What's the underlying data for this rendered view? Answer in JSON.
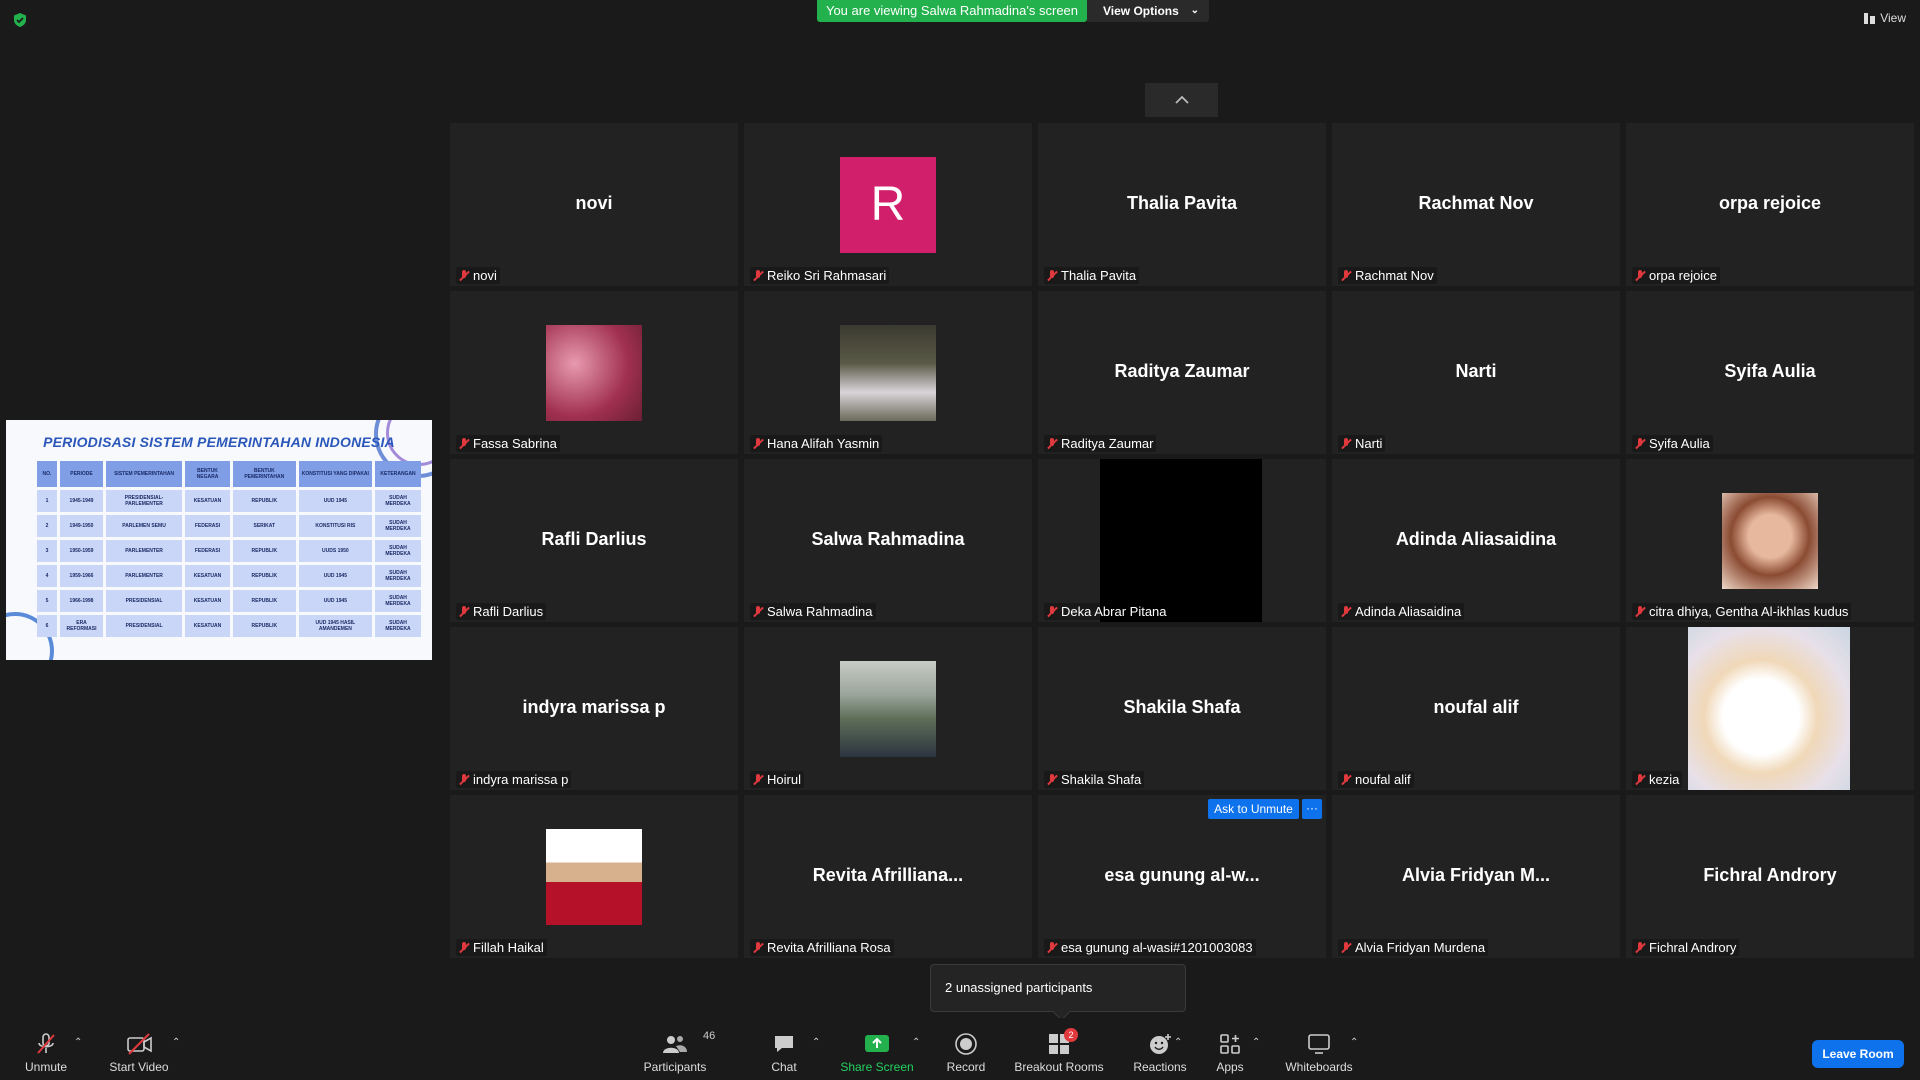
{
  "top": {
    "banner": "You are viewing Salwa Rahmadina's screen",
    "view_options": "View Options",
    "view": "View"
  },
  "slide": {
    "title": "PERIODISASI SISTEM PEMERINTAHAN INDONESIA",
    "headers": [
      "NO.",
      "PERIODE",
      "SISTEM PEMERINTAHAN",
      "BENTUK NEGARA",
      "BENTUK PEMERINTAHAN",
      "KONSTITUSI YANG DIPAKAI",
      "KETERANGAN"
    ],
    "rows": [
      [
        "1",
        "1945-1949",
        "PRESIDENSIAL-PARLEMENTER",
        "KESATUAN",
        "REPUBLIK",
        "UUD 1945",
        "SUDAH MERDEKA"
      ],
      [
        "2",
        "1949-1950",
        "PARLEMEN SEMU",
        "FEDERASI",
        "SERIKAT",
        "KONSTITUSI RIS",
        "SUDAH MERDEKA"
      ],
      [
        "3",
        "1950-1959",
        "PARLEMENTER",
        "FEDERASI",
        "REPUBLIK",
        "UUDS 1950",
        "SUDAH MERDEKA"
      ],
      [
        "4",
        "1959-1966",
        "PARLEMENTER",
        "KESATUAN",
        "REPUBLIK",
        "UUD 1945",
        "SUDAH MERDEKA"
      ],
      [
        "5",
        "1966-1998",
        "PRESIDENSIAL",
        "KESATUAN",
        "REPUBLIK",
        "UUD 1945",
        "SUDAH MERDEKA"
      ],
      [
        "6",
        "ERA REFORMASI",
        "PRESIDENSIAL",
        "KESATUAN",
        "REPUBLIK",
        "UUD 1945 HASIL AMANDEMEN",
        "SUDAH MERDEKA"
      ]
    ]
  },
  "participants": [
    {
      "big": "novi",
      "label": "novi"
    },
    {
      "big": "",
      "label": "Reiko Sri Rahmasari",
      "letter": "R"
    },
    {
      "big": "Thalia Pavita",
      "label": "Thalia Pavita"
    },
    {
      "big": "Rachmat Nov",
      "label": "Rachmat Nov"
    },
    {
      "big": "orpa rejoice",
      "label": "orpa rejoice"
    },
    {
      "big": "",
      "label": "Fassa Sabrina",
      "photo": "pink"
    },
    {
      "big": "",
      "label": "Hana Alifah Yasmin",
      "photo": "girl"
    },
    {
      "big": "Raditya Zaumar",
      "label": "Raditya Zaumar"
    },
    {
      "big": "Narti",
      "label": "Narti"
    },
    {
      "big": "Syifa Aulia",
      "label": "Syifa Aulia"
    },
    {
      "big": "Rafli Darlius",
      "label": "Rafli Darlius"
    },
    {
      "big": "Salwa Rahmadina",
      "label": "Salwa Rahmadina"
    },
    {
      "big": "",
      "label": "Deka Abrar Pitana",
      "video": "black"
    },
    {
      "big": "Adinda Aliasaidina",
      "label": "Adinda Aliasaidina"
    },
    {
      "big": "",
      "label": "citra dhiya, Gentha Al-ikhlas kudus",
      "photo": "glasses"
    },
    {
      "big": "indyra marissa p",
      "label": "indyra marissa p"
    },
    {
      "big": "",
      "label": "Hoirul",
      "photo": "hills"
    },
    {
      "big": "Shakila Shafa",
      "label": "Shakila Shafa"
    },
    {
      "big": "noufal alif",
      "label": "noufal alif"
    },
    {
      "big": "",
      "label": "kezia",
      "photo": "hamster"
    },
    {
      "big": "",
      "label": "Fillah Haikal",
      "photo": "redjacket"
    },
    {
      "big": "Revita  Afrilliana...",
      "label": "Revita Afrilliana Rosa"
    },
    {
      "big": "esa gunung al-w...",
      "label": "esa gunung al-wasi#1201003083"
    },
    {
      "big": "Alvia Fridyan M...",
      "label": "Alvia Fridyan Murdena"
    },
    {
      "big": "Fichral Androry",
      "label": "Fichral Androry"
    }
  ],
  "ask_unmute": "Ask to Unmute",
  "more": "···",
  "tooltip": "2 unassigned participants",
  "toolbar": {
    "unmute": "Unmute",
    "start_video": "Start Video",
    "participants": "Participants",
    "participants_count": "46",
    "chat": "Chat",
    "share_screen": "Share Screen",
    "record": "Record",
    "breakout_rooms": "Breakout Rooms",
    "breakout_badge": "2",
    "reactions": "Reactions",
    "apps": "Apps",
    "whiteboards": "Whiteboards",
    "leave_room": "Leave Room"
  },
  "colors": {
    "banner_green": "#23b14d",
    "accent_blue": "#0e72ed",
    "muted_red": "#e0393e",
    "avatar_pink": "#d11f6b",
    "share_green": "#23b14d"
  }
}
